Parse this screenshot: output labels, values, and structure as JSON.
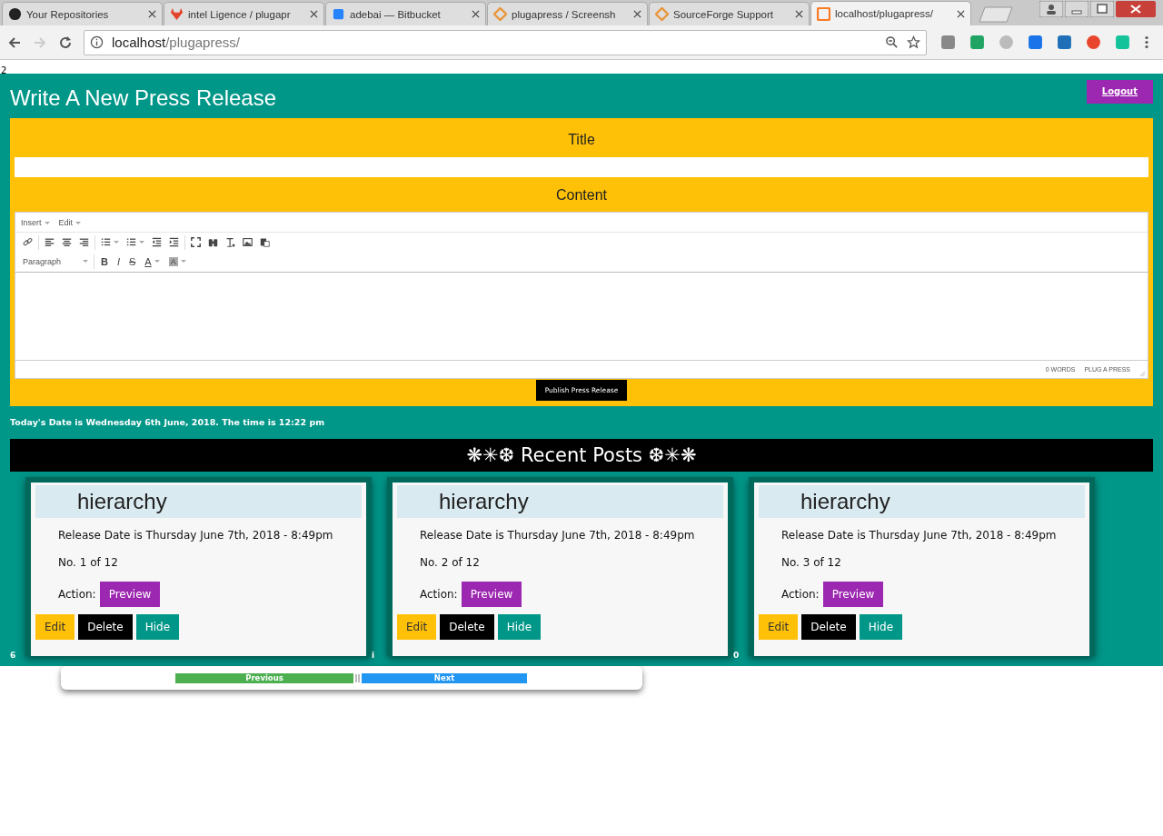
{
  "browser": {
    "tabs": [
      {
        "title": "Your Repositories",
        "kind": "github",
        "selected": false
      },
      {
        "title": "intel Ligence / plugapr",
        "kind": "gitlab",
        "selected": false
      },
      {
        "title": "adebai — Bitbucket",
        "kind": "bitbucket",
        "selected": false
      },
      {
        "title": "plugapress / Screensh",
        "kind": "diamond",
        "selected": false
      },
      {
        "title": "SourceForge Support",
        "kind": "diamond",
        "selected": false
      },
      {
        "title": "localhost/plugapress/",
        "kind": "xampp",
        "selected": true
      }
    ],
    "url_host": "localhost",
    "url_path": "/plugapress/"
  },
  "page_marker": "2",
  "header": {
    "title": "Write A New Press Release",
    "logout": "Logout"
  },
  "form": {
    "title_label": "Title",
    "content_label": "Content",
    "editor": {
      "menus": [
        "Insert",
        "Edit"
      ],
      "block_format": "Paragraph",
      "format_buttons": [
        {
          "label": "B",
          "kind": "bold"
        },
        {
          "label": "I",
          "kind": "italic"
        },
        {
          "label": "S",
          "kind": "strike"
        },
        {
          "label": "A",
          "kind": "color"
        },
        {
          "label": "A",
          "kind": "background"
        }
      ],
      "word_count": "0 WORDS",
      "brand": "PLUG A PRESS"
    },
    "submit": "Publish Press Release"
  },
  "date_line": "Today's Date is Wednesday 6th June, 2018. The time is 12:22 pm",
  "recent": {
    "title": "❋✳❆ Recent Posts ❆✳❋",
    "side_marks": [
      "6",
      "i",
      "0"
    ],
    "posts": [
      {
        "title": "hierarchy",
        "release": "Release Date is Thursday June 7th, 2018 - 8:49pm",
        "number": "No. 1 of 12",
        "action_label": "Action:",
        "preview": "Preview",
        "edit": "Edit",
        "delete": "Delete",
        "hide": "Hide"
      },
      {
        "title": "hierarchy",
        "release": "Release Date is Thursday June 7th, 2018 - 8:49pm",
        "number": "No. 2 of 12",
        "action_label": "Action:",
        "preview": "Preview",
        "edit": "Edit",
        "delete": "Delete",
        "hide": "Hide"
      },
      {
        "title": "hierarchy",
        "release": "Release Date is Thursday June 7th, 2018 - 8:49pm",
        "number": "No. 3 of 12",
        "action_label": "Action:",
        "preview": "Preview",
        "edit": "Edit",
        "delete": "Delete",
        "hide": "Hide"
      }
    ]
  },
  "pagination": {
    "previous": "Previous",
    "separator": "||",
    "next": "Next"
  }
}
